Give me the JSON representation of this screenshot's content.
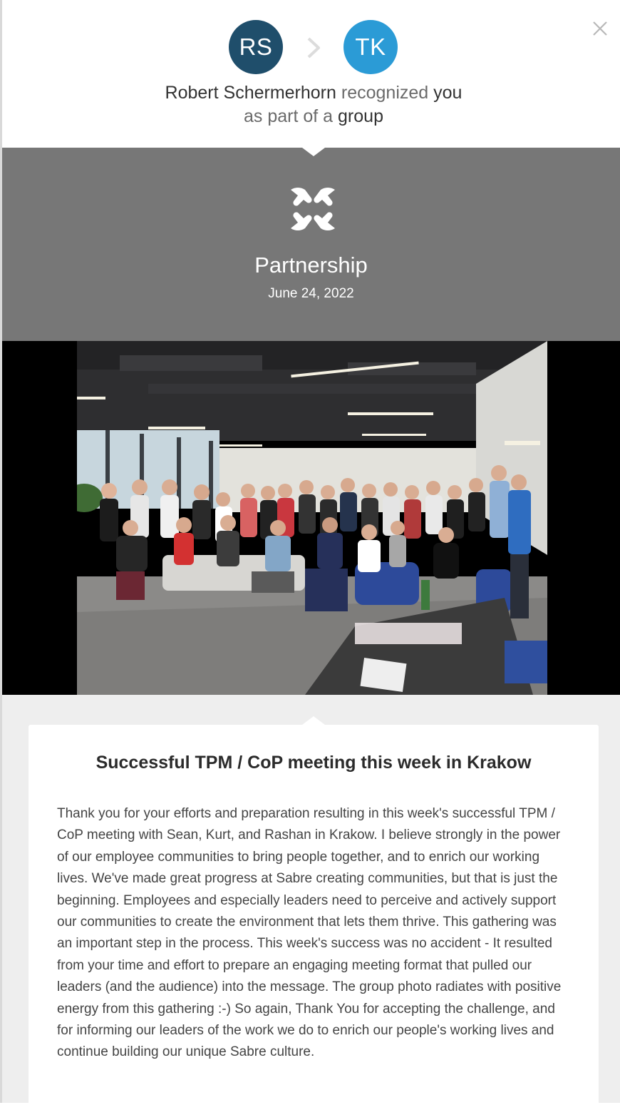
{
  "colors": {
    "sender_avatar": "#1f4e6b",
    "recipient_avatar": "#2b9bd6",
    "award_panel": "#777777"
  },
  "header": {
    "sender_initials": "RS",
    "recipient_initials": "TK",
    "sender_name": "Robert Schermerhorn",
    "verb": "recognized",
    "object": "you",
    "line2_prefix": "as part of a",
    "line2_emph": "group",
    "close_icon": "close-icon",
    "arrow_icon": "chevron-right-icon"
  },
  "award": {
    "icon": "partnership-hands-icon",
    "name": "Partnership",
    "date": "June 24, 2022"
  },
  "photo": {
    "alt_icon": "group-photo"
  },
  "message": {
    "title": "Successful TPM / CoP meeting this week in Krakow",
    "body": "Thank you for your efforts and preparation resulting in this week's successful TPM / CoP meeting with Sean, Kurt, and Rashan in Krakow. I believe strongly in the power of our employee communities to bring people together, and to enrich our working lives. We've made great progress at Sabre creating communities, but that is just the beginning. Employees and especially leaders need to perceive and actively support our communities to create the environment that lets them thrive. This gathering was an important step in the process. This week's success was no accident - It resulted from your time and effort to prepare an engaging meeting format that pulled our leaders (and the audience) into the message. The group photo radiates with positive energy from this gathering :-) So again, Thank You for accepting the challenge, and for informing our leaders of the work we do to enrich our people's working lives and continue building our unique Sabre culture."
  }
}
